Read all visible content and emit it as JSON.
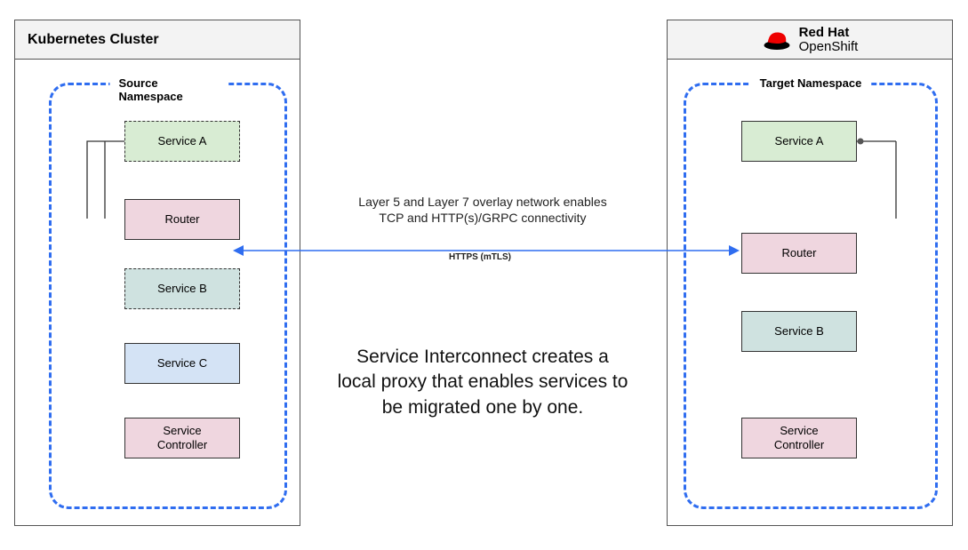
{
  "left_cluster": {
    "title": "Kubernetes Cluster",
    "namespace_label": "Source Namespace",
    "boxes": {
      "service_a": "Service A",
      "router": "Router",
      "service_b": "Service B",
      "service_c": "Service C",
      "service_controller": "Service\nController"
    }
  },
  "right_cluster": {
    "title_primary": "Red Hat",
    "title_secondary": "OpenShift",
    "namespace_label": "Target Namespace",
    "boxes": {
      "service_a": "Service A",
      "router": "Router",
      "service_b": "Service B",
      "service_controller": "Service\nController"
    }
  },
  "center": {
    "overlay_text": "Layer 5 and Layer 7 overlay network enables TCP and HTTP(s)/GRPC connectivity",
    "conn_label": "HTTPS (mTLS)",
    "description": "Service Interconnect creates a local proxy that enables services to be migrated one by one."
  }
}
